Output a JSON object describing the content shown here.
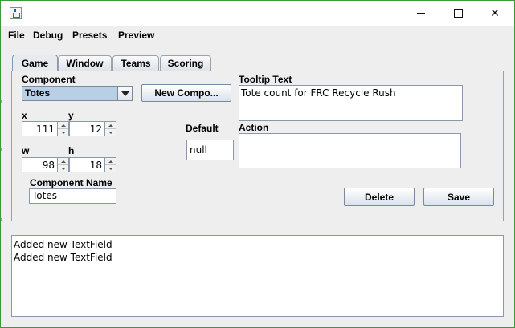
{
  "window": {
    "minimize_glyph": "—",
    "maximize_glyph": "☐",
    "close_glyph": "✕"
  },
  "menu": [
    "File",
    "Debug",
    "Presets",
    "Preview"
  ],
  "tabs": [
    {
      "label": "Game",
      "active": true
    },
    {
      "label": "Window",
      "active": false
    },
    {
      "label": "Teams",
      "active": false
    },
    {
      "label": "Scoring",
      "active": false
    }
  ],
  "form": {
    "component_label": "Component",
    "component_value": "Totes",
    "new_component_button": "New Compo...",
    "x_label": "x",
    "x_value": "111",
    "y_label": "y",
    "y_value": "12",
    "w_label": "w",
    "w_value": "98",
    "h_label": "h",
    "h_value": "18",
    "default_label": "Default",
    "default_value": "null",
    "component_name_label": "Component Name",
    "component_name_value": "Totes",
    "tooltip_label": "Tooltip Text",
    "tooltip_value": "Tote count for FRC Recycle Rush",
    "action_label": "Action",
    "action_value": "",
    "delete_button": "Delete",
    "save_button": "Save"
  },
  "log": [
    "Added new TextField",
    "Added new TextField"
  ],
  "colors": {
    "window_border": "#3a9a3a",
    "combo_selected": "#b8cfe5",
    "panel_border": "#8fa3b8"
  },
  "icons": {
    "app": "java-coffee-cup-icon",
    "dropdown": "chevron-down-icon",
    "spinner_up": "spinner-up-icon",
    "spinner_down": "spinner-down-icon"
  }
}
